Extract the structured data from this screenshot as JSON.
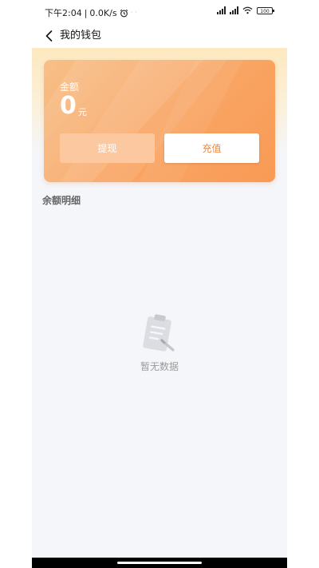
{
  "status_bar": {
    "time": "下午2:04",
    "network_speed": "0.0K/s",
    "battery": "100",
    "icons": [
      "alarm-icon",
      "signal-icon",
      "wifi-icon",
      "battery-icon"
    ]
  },
  "nav": {
    "title": "我的钱包"
  },
  "card": {
    "label": "金额",
    "amount": "0",
    "unit": "元",
    "withdraw_label": "提现",
    "recharge_label": "充值"
  },
  "details": {
    "title": "余额明细"
  },
  "empty": {
    "text": "暂无数据"
  },
  "colors": {
    "accent": "#f9a868",
    "recharge_text": "#f2863e",
    "background": "#f5f6fa"
  }
}
